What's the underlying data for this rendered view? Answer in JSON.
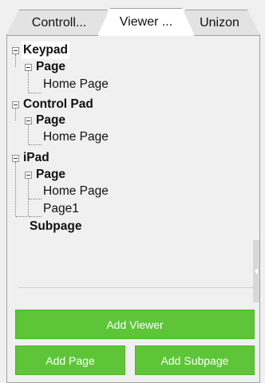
{
  "tabs": [
    {
      "label": "Controll..."
    },
    {
      "label": "Viewer ..."
    },
    {
      "label": "Unizon"
    }
  ],
  "tree": {
    "keypad": "Keypad",
    "keypad_page": "Page",
    "keypad_home": "Home Page",
    "control_pad": "Control Pad",
    "control_pad_page": "Page",
    "control_pad_home": "Home Page",
    "ipad": "iPad",
    "ipad_page": "Page",
    "ipad_home": "Home Page",
    "ipad_page1": "Page1",
    "ipad_subpage": "Subpage"
  },
  "buttons": {
    "add_viewer": "Add Viewer",
    "add_page": "Add Page",
    "add_subpage": "Add Subpage"
  },
  "colors": {
    "button_green": "#5ec539",
    "panel_bg": "#f0f0f0"
  }
}
